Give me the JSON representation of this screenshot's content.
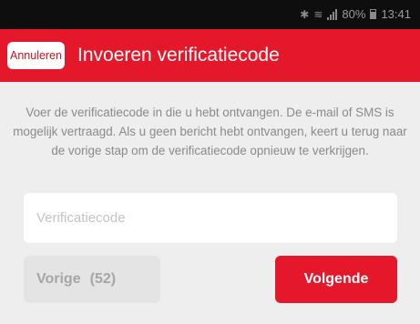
{
  "status_bar": {
    "icons": [
      "bluetooth-icon",
      "wifi-icon",
      "signal-icon",
      "battery-icon"
    ],
    "battery_percent": "80%",
    "time": "13:41"
  },
  "app_bar": {
    "cancel_label": "Annuleren",
    "title": "Invoeren verificatiecode"
  },
  "main": {
    "instruction": "Voer de verificatiecode in die u hebt ontvangen. De e-mail of SMS is mogelijk vertraagd. Als u geen bericht hebt ontvangen, keert u terug naar de vorige stap om de verificatiecode opnieuw te verkrijgen.",
    "code_input": {
      "placeholder": "Verificatiecode",
      "value": ""
    },
    "prev_button": {
      "label": "Vorige",
      "countdown": "(52)"
    },
    "next_button": {
      "label": "Volgende"
    }
  },
  "colors": {
    "accent": "#e5172a",
    "status_bar_bg": "#0e0e0e",
    "page_bg": "#eeeeee"
  }
}
